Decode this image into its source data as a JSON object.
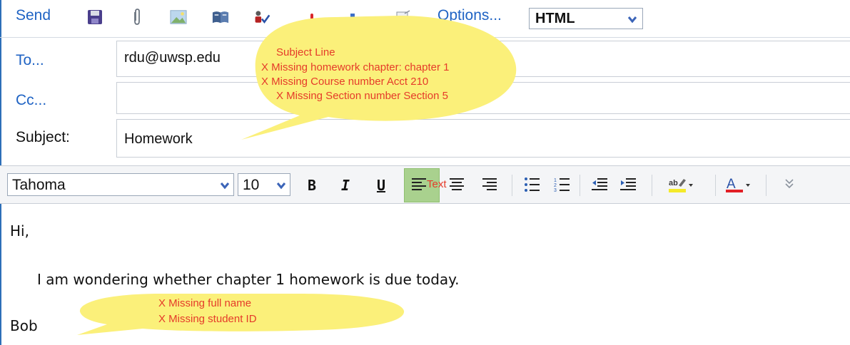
{
  "toolbar": {
    "send_label": "Send",
    "options_label": "Options...",
    "format_value": "HTML",
    "icons": [
      "save-icon",
      "attach-icon",
      "image-icon",
      "address-book-icon",
      "spellcheck-icon",
      "priority-high-icon",
      "priority-low-icon",
      "signature-icon"
    ]
  },
  "header": {
    "to_label": "To...",
    "to_value": "rdu@uwsp.edu",
    "cc_label": "Cc...",
    "cc_value": "",
    "subject_label": "Subject:",
    "subject_value": "Homework"
  },
  "format_toolbar": {
    "font": "Tahoma",
    "size": "10",
    "bold": "B",
    "italic": "I",
    "underline": "U",
    "align_tooltip": "Text"
  },
  "message": {
    "greeting": "Hi,",
    "body": "I am wondering whether chapter 1 homework is due today.",
    "signature": "Bob"
  },
  "annotations": {
    "subject_balloon": [
      "Subject Line",
      "X Missing homework chapter: chapter 1",
      "X Missing Course number Acct 210",
      "X Missing Section number Section 5"
    ],
    "signature_balloon": [
      "X Missing full name",
      "X Missing student ID"
    ]
  },
  "colors": {
    "link_blue": "#1f63c4",
    "annotation_red": "#e53b2a",
    "balloon_yellow": "#fbf07a",
    "active_green": "#a9d18e"
  }
}
